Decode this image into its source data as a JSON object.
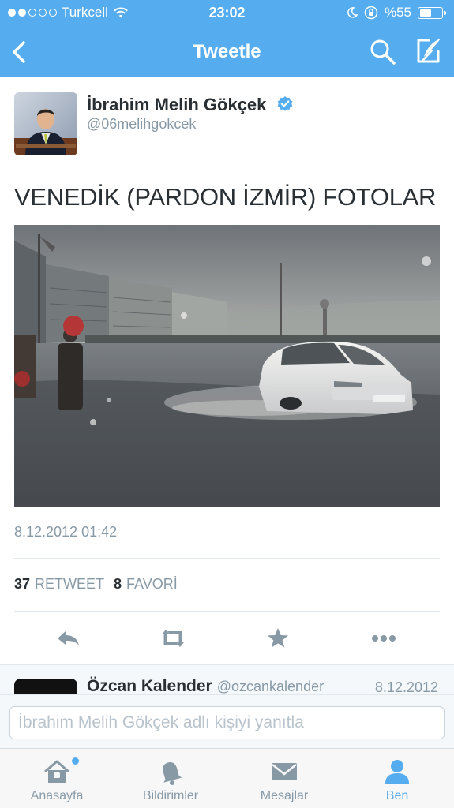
{
  "status_bar": {
    "carrier": "Turkcell",
    "time": "23:02",
    "battery": "%55",
    "battery_level": 0.55,
    "signal_bars_filled": 2
  },
  "nav": {
    "title": "Tweetle",
    "back_icon": "chevron-left-icon",
    "search_icon": "search-icon",
    "compose_icon": "compose-icon"
  },
  "tweet": {
    "author_name": "İbrahim Melih Gökçek",
    "handle": "@06melihgokcek",
    "verified": true,
    "text": "VENEDİK (PARDON İZMİR) FOTOLAR",
    "timestamp": "8.12.2012 01:42",
    "retweet_count": "37",
    "retweet_label": "RETWEET",
    "favorite_count": "8",
    "favorite_label": "FAVORİ"
  },
  "actions": [
    "reply-icon",
    "retweet-icon",
    "favorite-icon",
    "more-icon"
  ],
  "reply_preview": {
    "name": "Özcan Kalender",
    "handle": "@ozcankalender",
    "date": "8.12.2012"
  },
  "compose": {
    "placeholder": "İbrahim Melih Gökçek adlı kişiyi yanıtla"
  },
  "tabbar": [
    {
      "label": "Anasayfa",
      "icon": "home-icon",
      "active": false,
      "has_badge": true
    },
    {
      "label": "Bildirimler",
      "icon": "bell-icon",
      "active": false
    },
    {
      "label": "Mesajlar",
      "icon": "envelope-icon",
      "active": false
    },
    {
      "label": "Ben",
      "icon": "profile-icon",
      "active": true
    }
  ],
  "colors": {
    "brand": "#55acee",
    "text": "#292f33",
    "muted": "#8899a6"
  }
}
